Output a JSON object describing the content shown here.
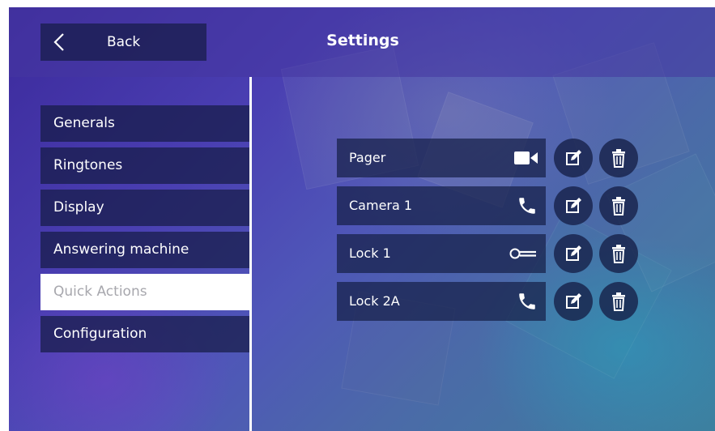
{
  "header": {
    "back_label": "Back",
    "title": "Settings"
  },
  "menu": {
    "items": [
      {
        "label": "Generals",
        "active": false
      },
      {
        "label": "Ringtones",
        "active": false
      },
      {
        "label": "Display",
        "active": false
      },
      {
        "label": "Answering machine",
        "active": false
      },
      {
        "label": "Quick Actions",
        "active": true
      },
      {
        "label": "Configuration",
        "active": false
      }
    ]
  },
  "quick_actions": [
    {
      "label": "Pager",
      "icon": "video-camera-icon"
    },
    {
      "label": "Camera 1",
      "icon": "phone-icon"
    },
    {
      "label": "Lock 1",
      "icon": "key-icon"
    },
    {
      "label": "Lock 2A",
      "icon": "phone-icon"
    }
  ],
  "row_actions": {
    "edit_icon": "edit-icon",
    "delete_icon": "trash-icon"
  },
  "colors": {
    "panel": "#161c46",
    "active_menu_bg": "#ffffff",
    "active_menu_text": "#a7a7ad",
    "text": "#ffffff"
  }
}
